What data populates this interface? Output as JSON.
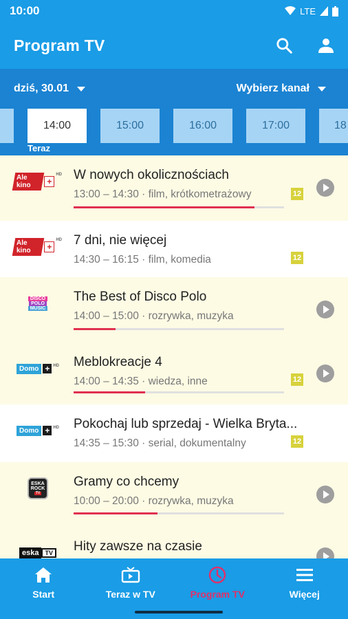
{
  "status_bar": {
    "time": "10:00",
    "network": "LTE"
  },
  "app_bar": {
    "title": "Program TV",
    "search_icon": "search-icon",
    "account_icon": "person-icon"
  },
  "filter": {
    "date_label": "dziś, 30.01",
    "channel_label": "Wybierz kanał"
  },
  "time_slots": [
    "",
    "14:00",
    "15:00",
    "16:00",
    "17:00",
    "18"
  ],
  "now_label": "Teraz",
  "programs": [
    {
      "channel": "Ale kino+",
      "title": "W nowych okolicznościach",
      "meta": "13:00 – 14:30 · film, krótkometrażowy",
      "age": "12",
      "progress": 0.86,
      "live": true
    },
    {
      "channel": "Ale kino+",
      "title": "7 dni, nie więcej",
      "meta": "14:30 – 16:15 · film, komedia",
      "age": "12",
      "progress": null,
      "live": false
    },
    {
      "channel": "Disco Polo Music",
      "title": "The Best of Disco Polo",
      "meta": "14:00 – 15:00 · rozrywka, muzyka",
      "age": null,
      "progress": 0.2,
      "live": true
    },
    {
      "channel": "Domo+",
      "title": "Meblokreacje 4",
      "meta": "14:00 – 14:35 · wiedza, inne",
      "age": "12",
      "progress": 0.34,
      "live": true
    },
    {
      "channel": "Domo+",
      "title": "Pokochaj lub sprzedaj - Wielka Bryta...",
      "meta": "14:35 – 15:30 · serial, dokumentalny",
      "age": "12",
      "progress": null,
      "live": false
    },
    {
      "channel": "Eska Rock TV",
      "title": "Gramy co chcemy",
      "meta": "10:00 – 20:00 · rozrywka, muzyka",
      "age": null,
      "progress": 0.4,
      "live": true
    },
    {
      "channel": "Eska TV",
      "title": "Hity zawsze na czasie",
      "meta": "",
      "age": null,
      "progress": null,
      "live": true
    }
  ],
  "logo_text": {
    "ale_kino": "Ale kino",
    "plus": "+",
    "hd": "HD",
    "disco": [
      "DISCO",
      "POLO",
      "MUSIC"
    ],
    "domo": "Domo",
    "eska_rock": [
      "ESKA",
      "ROCK",
      "TV"
    ],
    "eska": "eska",
    "tv": "TV"
  },
  "bottom_nav": [
    {
      "label": "Start",
      "icon": "home-icon",
      "active": false
    },
    {
      "label": "Teraz w TV",
      "icon": "tv-icon",
      "active": false
    },
    {
      "label": "Program TV",
      "icon": "clock-icon",
      "active": true
    },
    {
      "label": "Więcej",
      "icon": "menu-icon",
      "active": false
    }
  ],
  "colors": {
    "primary": "#1a9ce6",
    "filter_bg": "#1b83d2",
    "accent": "#e0306a",
    "live_row": "#fdfbe4",
    "progress": "#e0304f",
    "age_badge": "#d7d23c"
  }
}
